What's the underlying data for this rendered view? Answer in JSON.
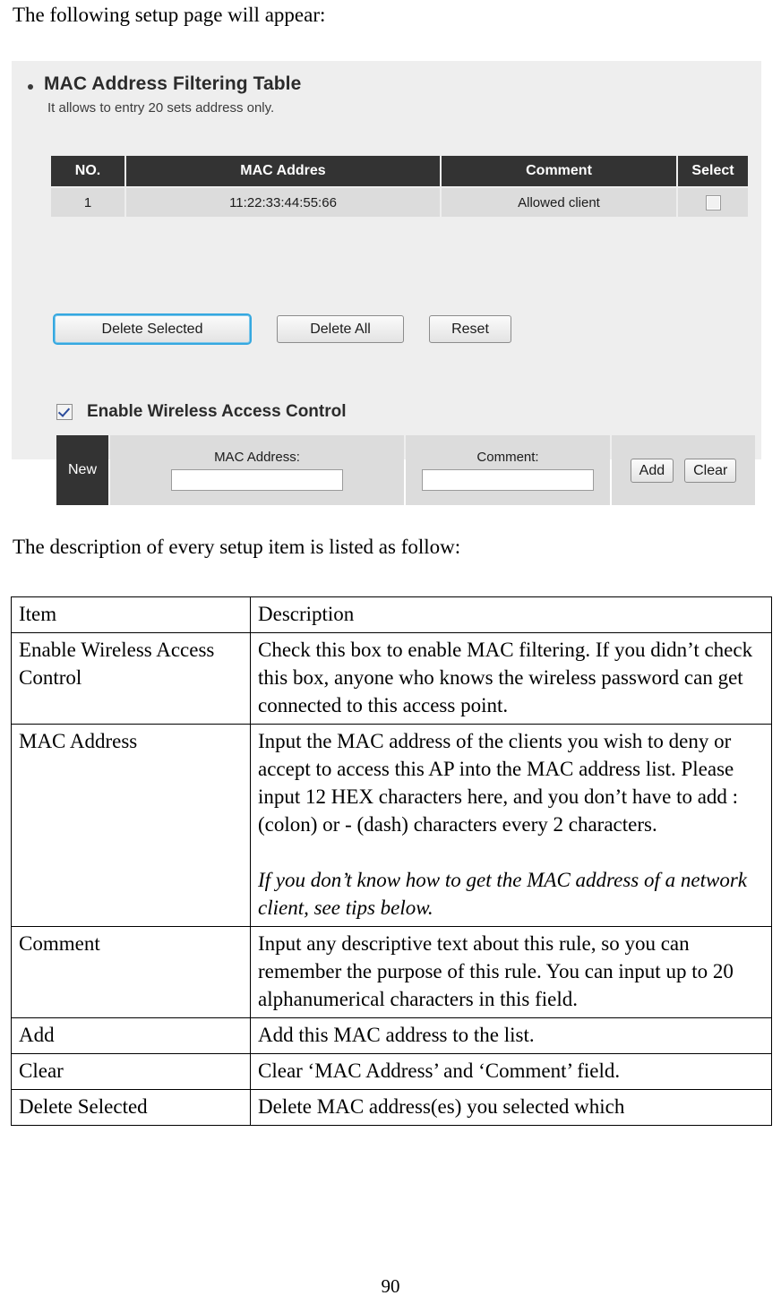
{
  "document": {
    "intro_paragraph": "The following setup page will appear:",
    "description_paragraph": "The description of every setup item is listed as follow:",
    "page_number": "90"
  },
  "screenshot": {
    "panel_title": "MAC Address Filtering Table",
    "panel_subtitle": "It allows to entry 20 sets address only.",
    "mac_table": {
      "headers": [
        "NO.",
        "MAC Addres",
        "Comment",
        "Select"
      ],
      "rows": [
        {
          "no": "1",
          "mac_address": "11:22:33:44:55:66",
          "comment": "Allowed client",
          "select_checked": false
        }
      ]
    },
    "buttons": {
      "delete_selected": "Delete Selected",
      "delete_all": "Delete All",
      "reset": "Reset"
    },
    "enable_access_control": {
      "label": "Enable Wireless Access Control",
      "checked": true
    },
    "new_entry": {
      "row_label": "New",
      "mac_address_caption": "MAC Address:",
      "mac_address_value": "",
      "mac_address_placeholder": "",
      "comment_caption": "Comment:",
      "comment_value": "",
      "comment_placeholder": "",
      "add_label": "Add",
      "clear_label": "Clear"
    },
    "colors": {
      "panel_background": "#eeeeee",
      "header_dark": "#333333",
      "row_gray": "#dcdcdc",
      "focus_ring_blue": "#35a8e0",
      "check_mark_blue": "#2b4b9b"
    }
  },
  "description_table": {
    "headers": [
      "Item",
      "Description"
    ],
    "rows": [
      {
        "item": "Enable Wireless Access Control",
        "description": "Check this box to enable MAC filtering. If you didn’t check this box, anyone who knows the wireless password can get connected to this access point.",
        "description_italic": ""
      },
      {
        "item": "MAC Address",
        "description": "Input the MAC address of the clients you wish to deny or accept to access this AP into the MAC address list. Please input 12 HEX characters here, and you don’t have to add : (colon) or - (dash) characters every 2 characters.",
        "description_italic": "If you don’t know how to get the MAC address of a network client, see tips below."
      },
      {
        "item": "Comment",
        "description": "Input any descriptive text about this rule, so you can remember the purpose of this rule. You can input up to 20 alphanumerical characters in this field.",
        "description_italic": ""
      },
      {
        "item": "Add",
        "description": "Add this MAC address to the list.",
        "description_italic": ""
      },
      {
        "item": "Clear",
        "description": "Clear ‘MAC Address’ and ‘Comment’ field.",
        "description_italic": ""
      },
      {
        "item": "Delete Selected",
        "description": "Delete MAC address(es) you selected which",
        "description_italic": ""
      }
    ]
  }
}
